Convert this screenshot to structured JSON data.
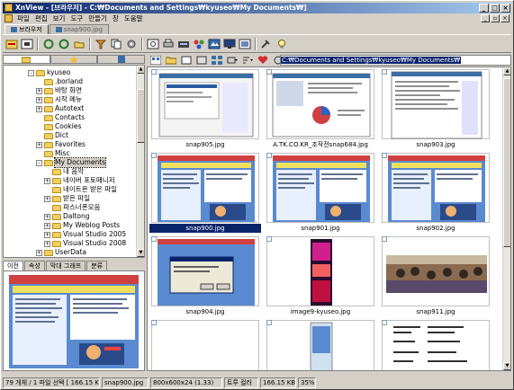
{
  "window": {
    "title": "XnView - [브라우저] - C:₩Documents and Settings₩kyuseo₩My Documents₩]"
  },
  "menu": [
    "파일",
    "편집",
    "보기",
    "도구",
    "만들기",
    "창",
    "도움말"
  ],
  "tabs": [
    {
      "label": "브라우저",
      "active": true
    },
    {
      "label": "snap900.jpg",
      "active": false
    }
  ],
  "address": "C:₩Documents and Settings₩kyuseo₩My Documents₩",
  "tree": [
    {
      "label": "kyuseo",
      "indent": 3,
      "expander": "-"
    },
    {
      "label": ".borland",
      "indent": 4,
      "expander": ""
    },
    {
      "label": "바탕 화면",
      "indent": 4,
      "expander": "+"
    },
    {
      "label": "시작 메뉴",
      "indent": 4,
      "expander": "+"
    },
    {
      "label": "Autotext",
      "indent": 4,
      "expander": "+"
    },
    {
      "label": "Contacts",
      "indent": 4,
      "expander": ""
    },
    {
      "label": "Cookies",
      "indent": 4,
      "expander": ""
    },
    {
      "label": "Dict",
      "indent": 4,
      "expander": ""
    },
    {
      "label": "Favorites",
      "indent": 4,
      "expander": "+"
    },
    {
      "label": "Misc",
      "indent": 4,
      "expander": ""
    },
    {
      "label": "My Documents",
      "indent": 4,
      "expander": "-",
      "selected": true
    },
    {
      "label": "내 음악",
      "indent": 5,
      "expander": ""
    },
    {
      "label": "네이버 포토매니저",
      "indent": 5,
      "expander": "+"
    },
    {
      "label": "네이트온 받은 파일",
      "indent": 5,
      "expander": ""
    },
    {
      "label": "받은 파일",
      "indent": 5,
      "expander": "+"
    },
    {
      "label": "파스너폰모음",
      "indent": 5,
      "expander": ""
    },
    {
      "label": "Daltong",
      "indent": 5,
      "expander": "+"
    },
    {
      "label": "My Weblog Posts",
      "indent": 5,
      "expander": "+"
    },
    {
      "label": "Visual Studio 2005",
      "indent": 5,
      "expander": "+"
    },
    {
      "label": "Visual Studio 2008",
      "indent": 5,
      "expander": "+"
    },
    {
      "label": "UserData",
      "indent": 4,
      "expander": "+"
    }
  ],
  "bottom_tabs": [
    {
      "label": "이전",
      "active": true
    },
    {
      "label": "속성",
      "active": false
    },
    {
      "label": "막대 그래프",
      "active": false
    },
    {
      "label": "분류",
      "active": false
    }
  ],
  "thumbs": [
    {
      "name": "snap905.jpg",
      "kind": "screen",
      "selected": false
    },
    {
      "name": "A.TK.CO.KR_조작전snap684.jpg",
      "kind": "web",
      "selected": false
    },
    {
      "name": "snap903.jpg",
      "kind": "doc",
      "selected": false
    },
    {
      "name": "snap900.jpg",
      "kind": "game",
      "selected": true
    },
    {
      "name": "snap901.jpg",
      "kind": "game",
      "selected": false
    },
    {
      "name": "snap902.jpg",
      "kind": "game",
      "selected": false
    },
    {
      "name": "snap904.jpg",
      "kind": "dialog",
      "selected": false
    },
    {
      "name": "image9-kyuseo.jpg",
      "kind": "mobile",
      "selected": false
    },
    {
      "name": "snap911.jpg",
      "kind": "photo",
      "selected": false
    },
    {
      "name": "",
      "kind": "blank",
      "selected": false
    },
    {
      "name": "",
      "kind": "tall",
      "selected": false
    },
    {
      "name": "",
      "kind": "text",
      "selected": false
    }
  ],
  "status": [
    "79 개체 / 1 파일 선택  [ 166.15 KB ]",
    "snap900.jpg",
    "800x600x24 (1.33)",
    "트루 컬러",
    "166.15 KB",
    "35%"
  ],
  "colors": {
    "titlebar": "#0a246a",
    "selection": "#0a246a",
    "folder": "#f0d060"
  }
}
